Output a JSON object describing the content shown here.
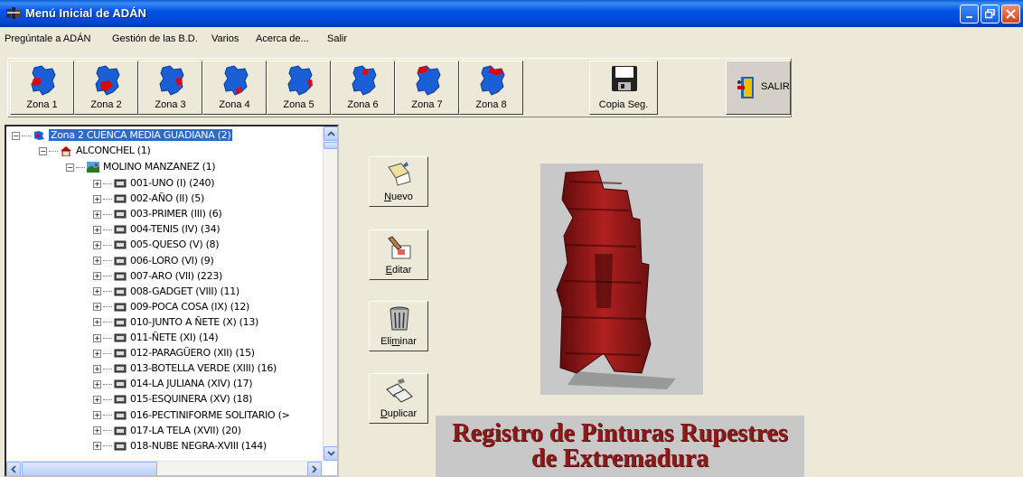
{
  "window": {
    "title": "Menú Inicial de ADÁN",
    "controls": [
      "minimize",
      "maximize",
      "close"
    ]
  },
  "menu": [
    "Pregúntale a ADÁN",
    "Gestión de las B.D.",
    "Varios",
    "Acerca de...",
    "Salir"
  ],
  "zones": [
    {
      "label": "Zona 1"
    },
    {
      "label": "Zona 2"
    },
    {
      "label": "Zona 3"
    },
    {
      "label": "Zona 4"
    },
    {
      "label": "Zona 5"
    },
    {
      "label": "Zona 6"
    },
    {
      "label": "Zona 7"
    },
    {
      "label": "Zona 8"
    }
  ],
  "backup_button": "Copia Seg.",
  "exit_button": "SALIR",
  "tree": {
    "root": "Zona 2 CUENCA MEDIA GUADIANA (2)",
    "town": "ALCONCHEL (1)",
    "site": "MOLINO MANZANEZ (1)",
    "items": [
      "001-UNO (I) (240)",
      "002-AÑO (II) (5)",
      "003-PRIMER (III) (6)",
      "004-TENIS (IV) (34)",
      "005-QUESO  (V)  (8)",
      "006-LORO (VI) (9)",
      "007-ARO (VII) (223)",
      "008-GADGET (VIII) (11)",
      "009-POCA COSA (IX) (12)",
      "010-JUNTO A ÑETE (X) (13)",
      "011-ÑETE (XI) (14)",
      "012-PARAGÜERO (XII) (15)",
      "013-BOTELLA VERDE (XIII) (16)",
      "014-LA JULIANA (XIV) (17)",
      "015-ESQUINERA (XV) (18)",
      "016-PECTINIFORME SOLITARIO (>",
      "017-LA TELA (XVII) (20)",
      "018-NUBE NEGRA-XVIII (144)"
    ]
  },
  "actions": {
    "new": {
      "pre": "",
      "u": "N",
      "post": "uevo"
    },
    "edit": {
      "pre": "",
      "u": "E",
      "post": "ditar"
    },
    "delete": {
      "pre": "Eli",
      "u": "m",
      "post": "inar"
    },
    "duplicate": {
      "pre": "",
      "u": "D",
      "post": "uplicar"
    }
  },
  "banner": {
    "line1": "Registro de Pinturas Rupestres",
    "line2": "de Extremadura"
  },
  "colors": {
    "title_bar": "#0055e5",
    "selection": "#316ac5",
    "banner_text": "#8b1a1a",
    "map_blue": "#1a5fd6",
    "map_red": "#e00000"
  }
}
